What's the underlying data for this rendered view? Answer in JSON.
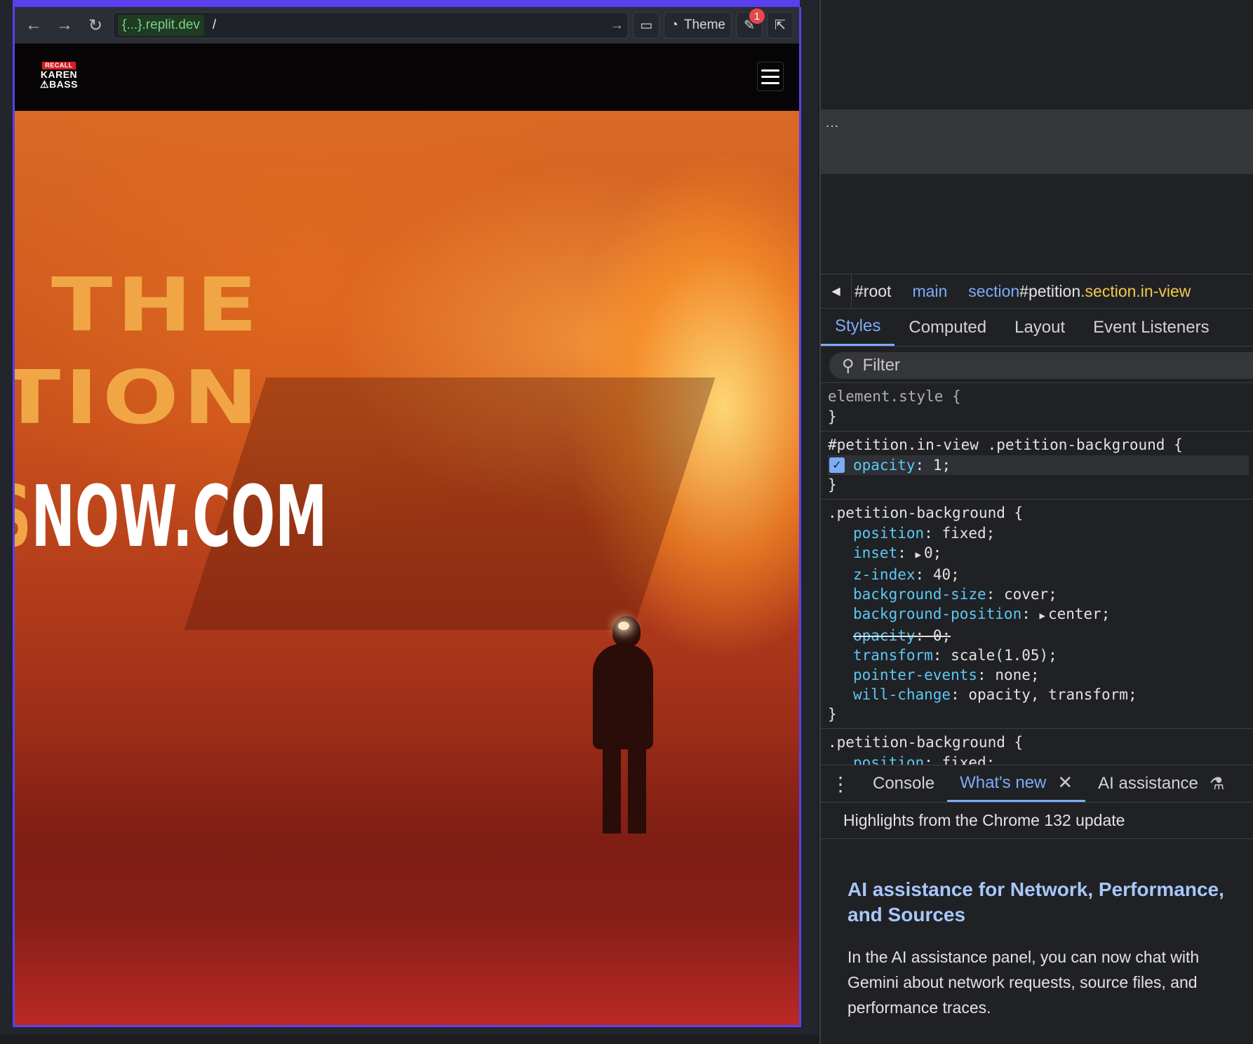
{
  "browser": {
    "host": "{...}.replit.dev",
    "path": "/",
    "theme_label": "Theme",
    "devtools_badge": "1"
  },
  "site": {
    "logo": {
      "line1": "RECALL",
      "line2": "KAREN",
      "line3": "⚠BASS"
    },
    "hero": {
      "line1": "THE",
      "line2": "TION",
      "line3_accent": "S",
      "line3_rest": "NOW.COM"
    }
  },
  "devtools": {
    "dom_overflow": "…",
    "breadcrumbs": [
      {
        "text": "#root"
      },
      {
        "tag": "main"
      },
      {
        "tag": "section",
        "id": "#petition",
        "cls": ".section.in-view"
      }
    ],
    "tabs": [
      "Styles",
      "Computed",
      "Layout",
      "Event Listeners"
    ],
    "filter_placeholder": "Filter",
    "rules": {
      "element_style": "element.style {",
      "r1_selector": "#petition.in-view .petition-background {",
      "r1_prop": {
        "name": "opacity",
        "value": " 1;"
      },
      "r2_selector": ".petition-background {",
      "r2_props": [
        {
          "name": "position",
          "value": " fixed;"
        },
        {
          "name": "inset",
          "value": "0;",
          "expand": true
        },
        {
          "name": "z-index",
          "value": " 40;"
        },
        {
          "name": "background-size",
          "value": " cover;"
        },
        {
          "name": "background-position",
          "value": "center;",
          "expand": true
        },
        {
          "name": "opacity",
          "value": " 0;",
          "strike": true
        },
        {
          "name": "transform",
          "value": " scale(1.05);"
        },
        {
          "name": "pointer-events",
          "value": " none;"
        },
        {
          "name": "will-change",
          "value": " opacity, transform;"
        }
      ],
      "r3_selector": ".petition-background {",
      "r3_prop": {
        "name": "position",
        "value": " fixed;"
      },
      "close_brace": "}"
    },
    "drawer_tabs": {
      "console": "Console",
      "whats_new": "What's new",
      "ai": "AI assistance"
    },
    "whats_new_header": "Highlights from the Chrome 132 update",
    "article": {
      "title": "AI assistance for Network, Performance, and Sources",
      "body": "In the AI assistance panel, you can now chat with Gemini about network requests, source files, and performance traces."
    }
  }
}
